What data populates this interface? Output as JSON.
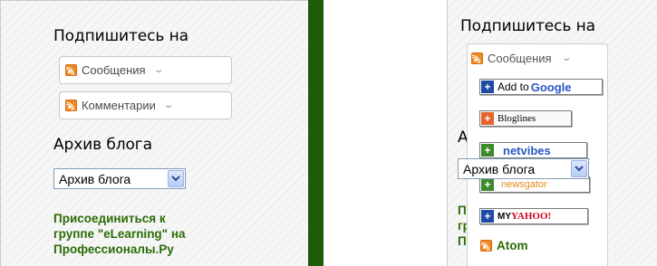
{
  "left": {
    "subscribe_heading": "Подпишитесь на",
    "posts_label": "Сообщения",
    "comments_label": "Комментарии",
    "archive_heading": "Архив блога",
    "archive_select_value": "Архив блога",
    "join_link_lines": [
      "Присоединиться к",
      "группе \"eLearning\" на",
      "Профессионалы.Ру"
    ]
  },
  "right": {
    "subscribe_heading": "Подпишитесь на",
    "posts_label": "Сообщения",
    "feed_options": {
      "google": {
        "prefix": "Add to ",
        "brand": "Google"
      },
      "bloglines": "Bloglines",
      "netvibes": "netvibes",
      "newsgator": "newsgator",
      "myyahoo": {
        "prefix": "MY ",
        "brand": "YAHOO!"
      },
      "atom": "Atom"
    },
    "archive_select_value": "Архив блога",
    "hidden_heading_fragment": "А",
    "hidden_link_fragments": [
      "П",
      "гр",
      "П"
    ]
  },
  "colors": {
    "accent_green": "#2b6d06",
    "sidebar_green": "#1e5c0d",
    "rss_orange": "#f08a22",
    "select_border": "#7f9db9"
  },
  "icons": [
    "rss-icon",
    "chevron-down-icon",
    "plus-icon",
    "dropdown-arrow-icon"
  ]
}
